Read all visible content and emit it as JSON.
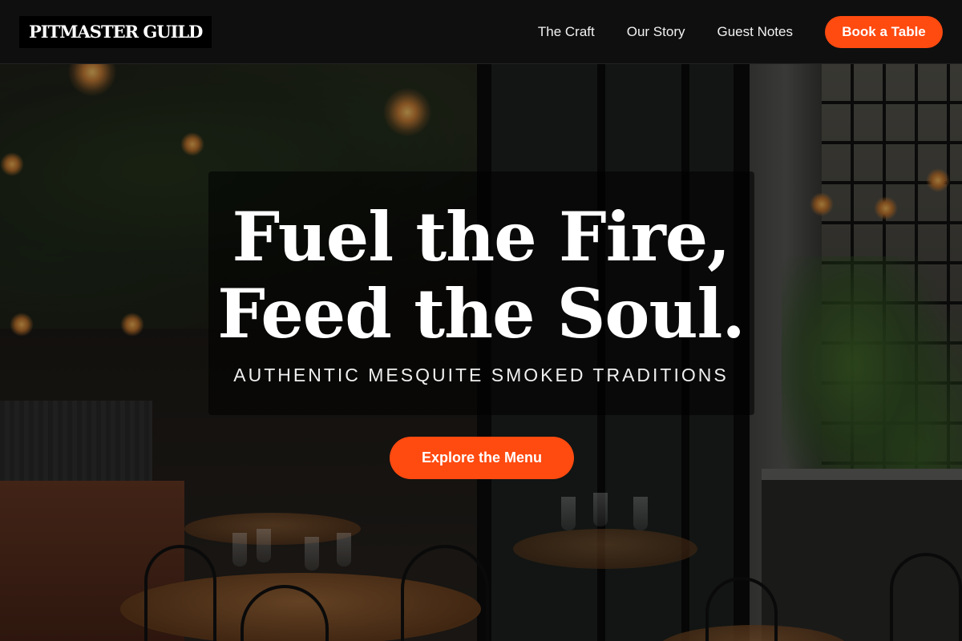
{
  "header": {
    "logo": "PITMASTER GUILD",
    "nav": [
      {
        "label": "The Craft"
      },
      {
        "label": "Our Story"
      },
      {
        "label": "Guest Notes"
      }
    ],
    "cta_label": "Book a Table"
  },
  "hero": {
    "headline_line1": "Fuel the Fire,",
    "headline_line2": "Feed the Soul.",
    "tagline": "AUTHENTIC MESQUITE SMOKED TRADITIONS",
    "cta_label": "Explore the Menu",
    "background_image": "restaurant-interior-photo"
  },
  "colors": {
    "accent": "#ff4a10",
    "header_bg": "#0f0f0f",
    "text": "#ffffff"
  }
}
